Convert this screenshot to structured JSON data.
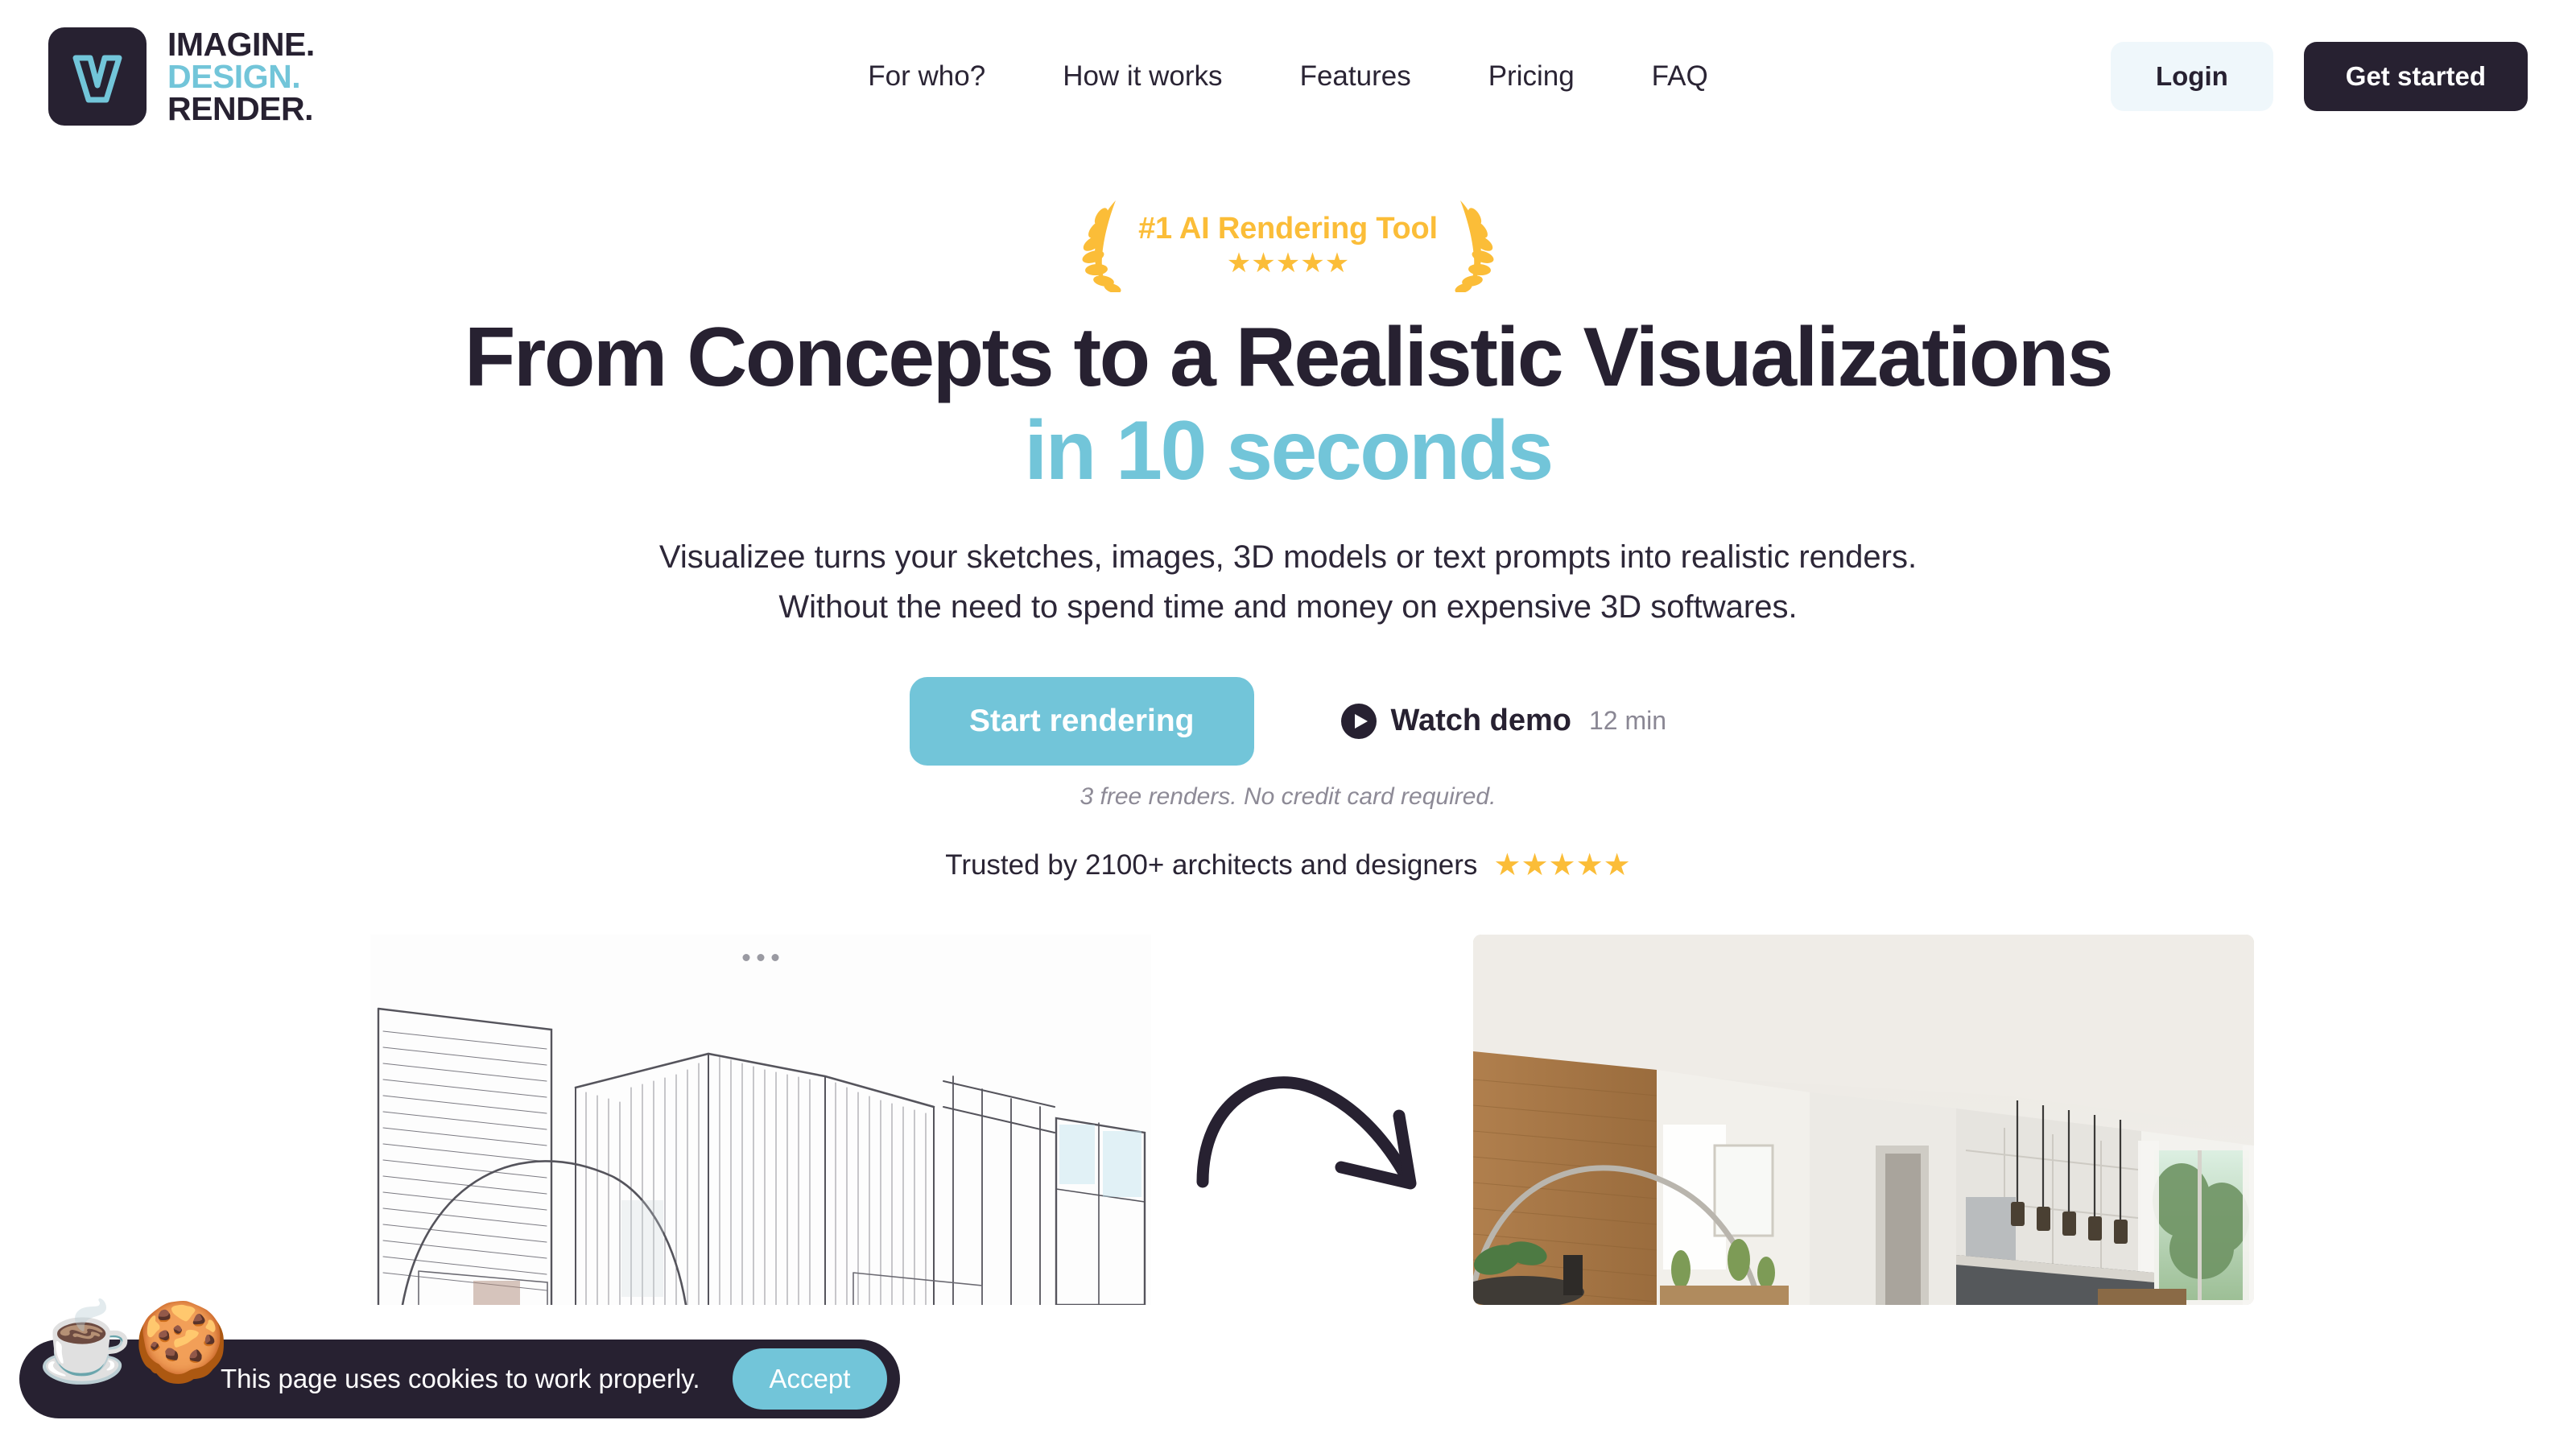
{
  "brand": {
    "logo_icon": "letter-v-logo",
    "wordmark_line1": "IMAGINE.",
    "wordmark_line2": "DESIGN.",
    "wordmark_line3": "RENDER.",
    "mark_bg": "#272131",
    "accent": "#72C5D9"
  },
  "nav": {
    "items": [
      {
        "label": "For who?"
      },
      {
        "label": "How it works"
      },
      {
        "label": "Features"
      },
      {
        "label": "Pricing"
      },
      {
        "label": "FAQ"
      }
    ],
    "login_label": "Login",
    "get_started_label": "Get started"
  },
  "hero": {
    "badge_text": "#1 AI Rendering Tool",
    "badge_stars": "★★★★★",
    "badge_color": "#FBBD38",
    "headline_line1": "From Concepts to a Realistic Visualizations",
    "headline_line2": "in 10 seconds",
    "subtitle_line1": "Visualizee turns your sketches, images, 3D models or text prompts into realistic renders.",
    "subtitle_line2": "Without the need to spend time and money on expensive 3D softwares.",
    "primary_cta": "Start rendering",
    "watch_demo_label": "Watch demo",
    "watch_demo_duration": "12 min",
    "fineprint": "3 free renders. No credit card required.",
    "trust_text": "Trusted by 2100+ architects and designers",
    "trust_stars": "★★★★★"
  },
  "showcase": {
    "sketch_caption": "architectural line sketch",
    "arrow_icon": "curved-arrow-right",
    "render_caption": "photorealistic interior render"
  },
  "cookie": {
    "emoji": "☕🍪",
    "message": "This page uses cookies to work properly.",
    "accept_label": "Accept"
  }
}
